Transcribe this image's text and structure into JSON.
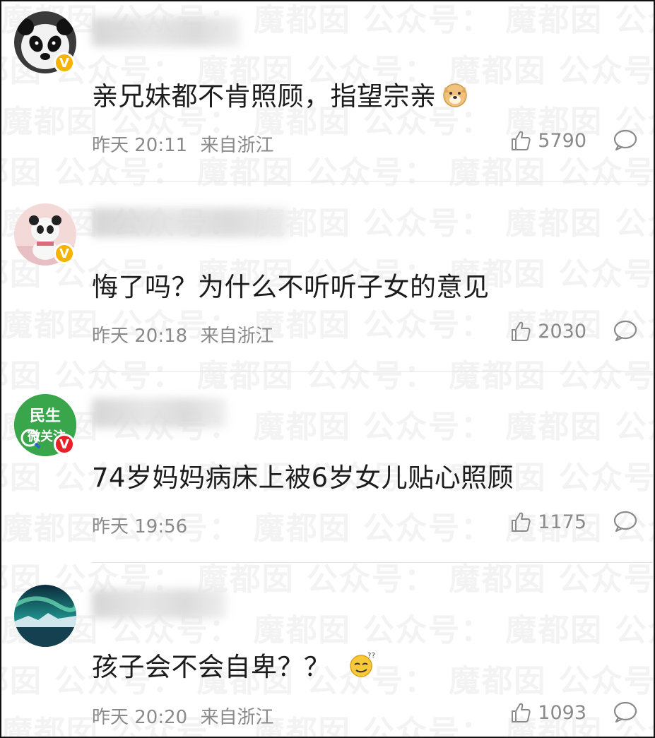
{
  "watermark": "魔都囡 公众号：",
  "comments": [
    {
      "avatar_icon": "panda-avatar",
      "badge": "V",
      "badge_color": "#f5b400",
      "text": "亲兄妹都不肯照顾，指望宗亲",
      "emoji": "doge-emoji",
      "time": "昨天 20:11",
      "location": "来自浙江",
      "likes": "5790"
    },
    {
      "avatar_icon": "panda-plush-avatar",
      "badge": "V",
      "badge_color": "#f5b400",
      "text": "悔了吗？为什么不听听子女的意见",
      "emoji": "",
      "time": "昨天 20:18",
      "location": "来自浙江",
      "likes": "2030"
    },
    {
      "avatar_icon": "minsheng-weiguanzhu-logo",
      "avatar_text_top": "民生",
      "avatar_text_bottom": "微关注",
      "badge": "V",
      "badge_color": "#e8202a",
      "text": "74岁妈妈病床上被6岁女儿贴心照顾",
      "emoji": "",
      "time": "昨天 19:56",
      "location": "",
      "likes": "1175"
    },
    {
      "avatar_icon": "aurora-landscape-avatar",
      "badge": "",
      "text": "孩子会不会自卑？？",
      "emoji": "confused-emoji",
      "time": "昨天 20:20",
      "location": "来自浙江",
      "likes": "1093"
    }
  ]
}
